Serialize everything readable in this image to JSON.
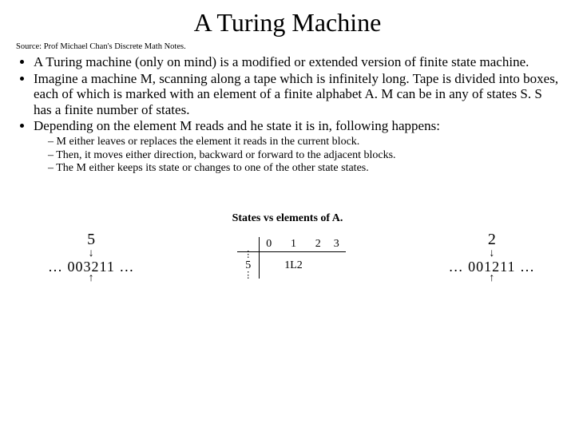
{
  "title": "A Turing Machine",
  "source": "Source: Prof Michael Chan's Discrete Math Notes.",
  "bullets": {
    "b1": "A Turing machine (only on mind) is a modified or extended version of finite state machine.",
    "b2": "Imagine a machine M, scanning along a tape which is infinitely long. Tape is divided into boxes, each of which is marked with an element of a finite alphabet A. M can be in any of states S. S has a finite number of states.",
    "b3": "Depending on the element M reads and he state it is in, following happens:",
    "s1": "M either leaves or replaces the element it reads in the current block.",
    "s2": "Then, it moves either direction, backward or forward to the adjacent blocks.",
    "s3": "The M either keeps its state or changes to one of the other state states."
  },
  "caption": "States vs elements of A.",
  "leftTape": {
    "head": "5",
    "cells": "… 003211 …",
    "arrowDown": "↓",
    "arrowUp": "↑"
  },
  "table": {
    "cols": [
      "0",
      "1",
      "2",
      "3"
    ],
    "rowLabel": "5",
    "cell": "1L2",
    "vdots": "⋮"
  },
  "rightTape": {
    "head": "2",
    "cells": "… 001211 …",
    "arrowDown": "↓",
    "arrowUp": "↑"
  }
}
